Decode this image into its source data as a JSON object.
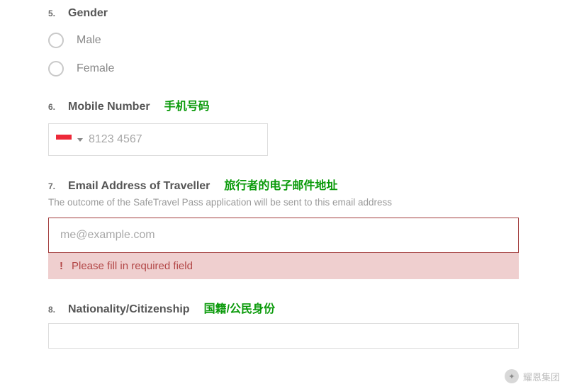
{
  "q5": {
    "num": "5.",
    "label": "Gender",
    "options": {
      "male": "Male",
      "female": "Female"
    }
  },
  "q6": {
    "num": "6.",
    "label": "Mobile Number",
    "anno": "手机号码",
    "placeholder": "8123 4567"
  },
  "q7": {
    "num": "7.",
    "label": "Email Address of Traveller",
    "anno": "旅行者的电子邮件地址",
    "helper": "The outcome of the SafeTravel Pass application will be sent to this email address",
    "placeholder": "me@example.com",
    "error_icon": "!",
    "error": "Please fill in required field"
  },
  "q8": {
    "num": "8.",
    "label": "Nationality/Citizenship",
    "anno": "国籍/公民身份"
  },
  "watermark": "耀恩集团"
}
